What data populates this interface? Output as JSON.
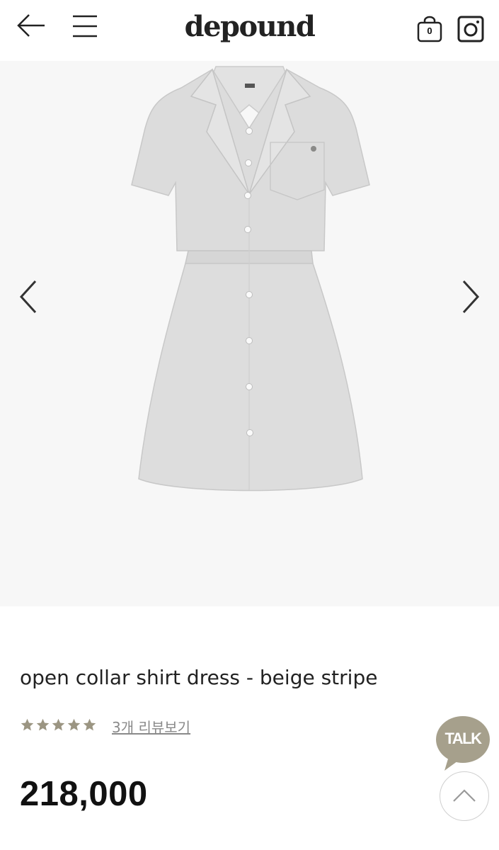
{
  "header": {
    "logo_text": "depound",
    "cart_count": "0",
    "icons": [
      "back-arrow-icon",
      "hamburger-menu-icon",
      "shopping-bag-icon",
      "instagram-icon"
    ]
  },
  "gallery": {
    "image_alt": "open collar shirt dress",
    "prev_icon": "chevron-left-icon",
    "next_icon": "chevron-right-icon"
  },
  "product": {
    "title": "open collar shirt dress - beige stripe",
    "rating_stars": 5,
    "review_link": "3개 리뷰보기",
    "price": "218,000"
  },
  "floating": {
    "talk_label": "TALK",
    "scroll_top_icon": "chevron-up-icon"
  },
  "colors": {
    "page_background": "#ffffff",
    "gallery_background": "#f7f7f7",
    "star": "#9b9582",
    "talk_bubble": "#a6a08c",
    "review_link": "#8a8a8a",
    "dress": "#dcdcdc"
  }
}
